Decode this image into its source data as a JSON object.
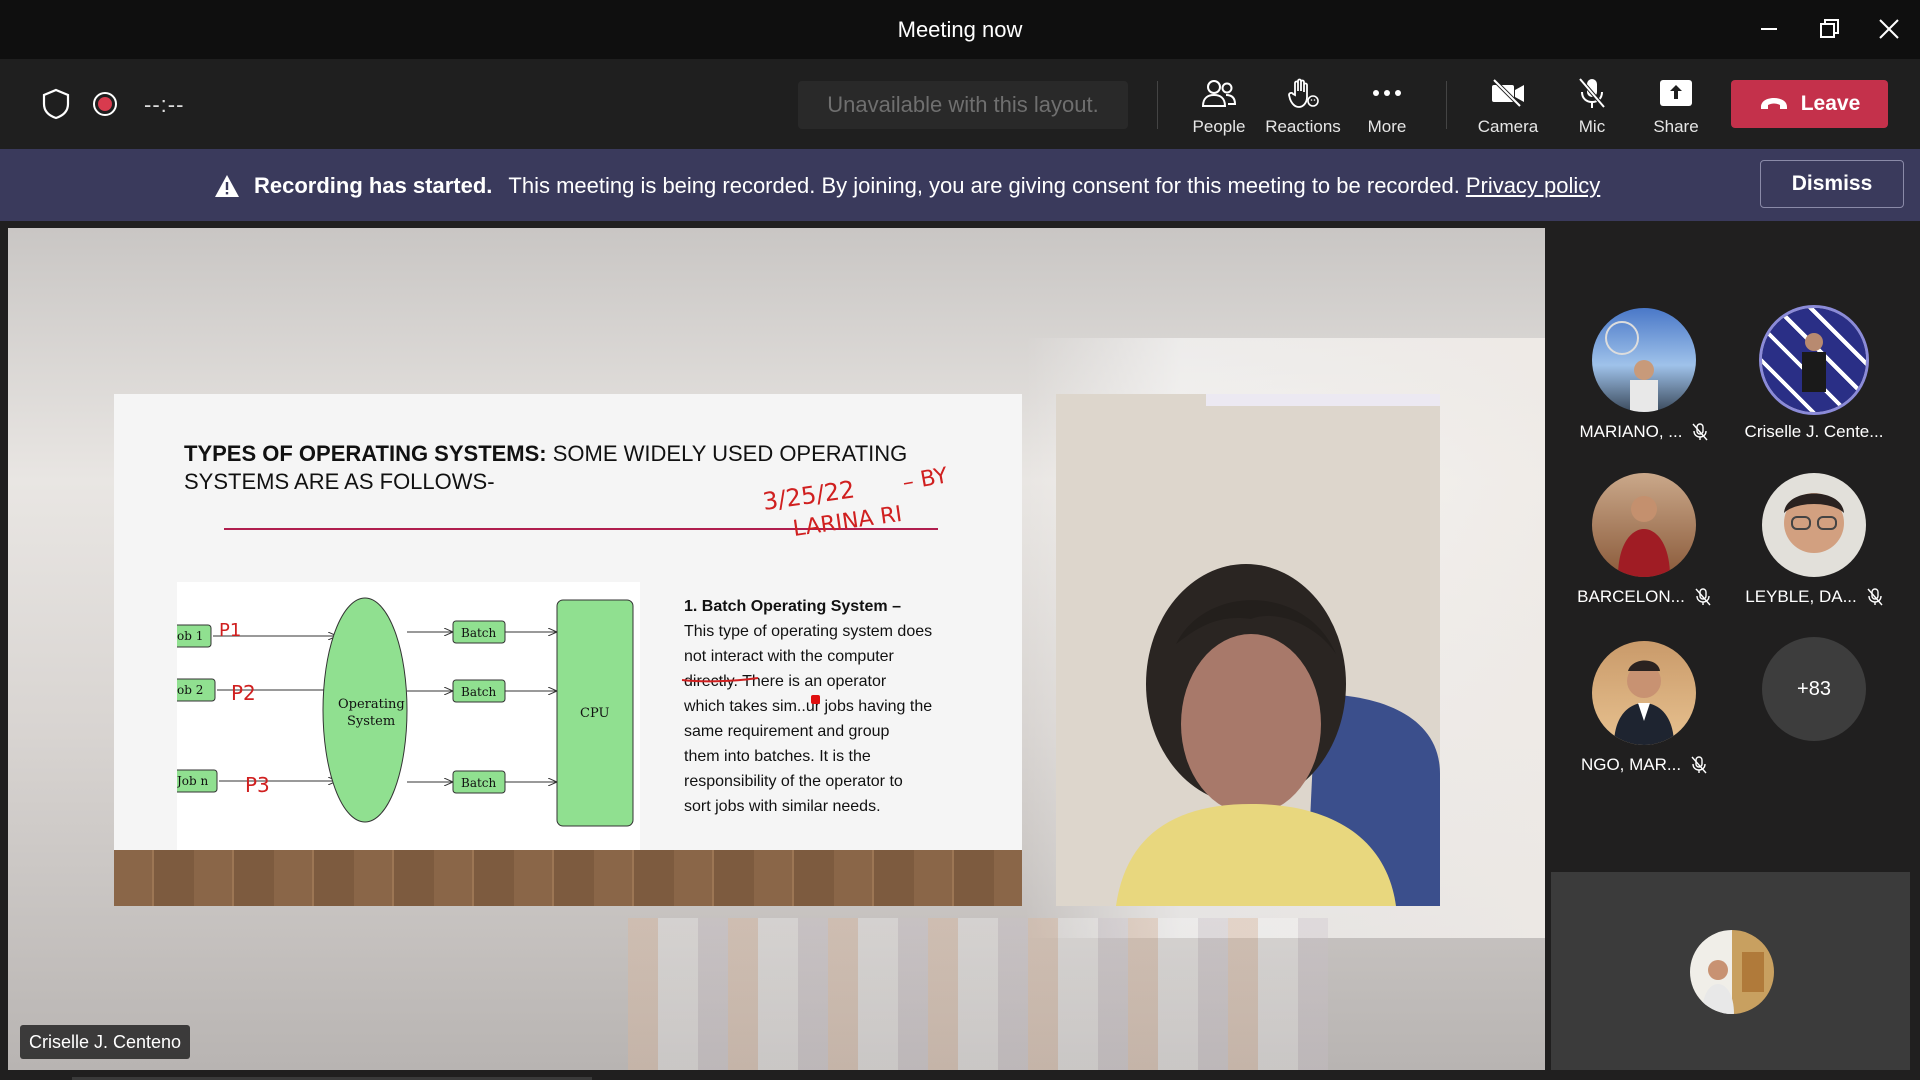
{
  "window": {
    "title": "Meeting now"
  },
  "toolbar": {
    "timer": "--:--",
    "layout_notice": "Unavailable with this layout.",
    "people_label": "People",
    "reactions_label": "Reactions",
    "more_label": "More",
    "camera_label": "Camera",
    "mic_label": "Mic",
    "share_label": "Share",
    "leave_label": "Leave"
  },
  "banner": {
    "bold_text": "Recording has started.",
    "text": "This meeting is being recorded. By joining, you are giving consent for this meeting to be recorded.",
    "link": "Privacy policy",
    "dismiss_label": "Dismiss"
  },
  "slide": {
    "heading_bold": "TYPES OF OPERATING SYSTEMS:",
    "heading_rest": " SOME WIDELY USED OPERATING SYSTEMS ARE AS FOLLOWS-",
    "diagram": {
      "jobs": [
        "ob 1",
        "ob 2",
        "Job n"
      ],
      "os_line1": "Operating",
      "os_line2": "System",
      "batches": [
        "Batch",
        "Batch",
        "Batch"
      ],
      "cpu": "CPU",
      "annotations": [
        "P1",
        "P2",
        "P3"
      ]
    },
    "desc_title": "1. Batch Operating System –",
    "desc_lines": [
      "This type of operating system does",
      "not interact with the computer",
      "directly. There is an operator",
      "which takes sim..ur jobs having the",
      "same requirement and group",
      "them into batches. It is the",
      "responsibility of the operator to",
      "sort jobs with similar needs."
    ],
    "handwriting": {
      "date": "3/25/22",
      "by": "– BY",
      "name": "LARINA RI"
    }
  },
  "presenter_name": "Criselle J. Centeno",
  "participants": [
    {
      "name": "MARIANO, ...",
      "muted": true
    },
    {
      "name": "Criselle J. Cente...",
      "muted": false
    },
    {
      "name": "BARCELON...",
      "muted": true
    },
    {
      "name": "LEYBLE, DA...",
      "muted": true
    },
    {
      "name": "NGO, MAR...",
      "muted": true
    }
  ],
  "more_participants": "+83",
  "colors": {
    "leave": "#c4314b",
    "banner": "#3a3a5c",
    "speaking_ring": "#8b8bd8"
  }
}
